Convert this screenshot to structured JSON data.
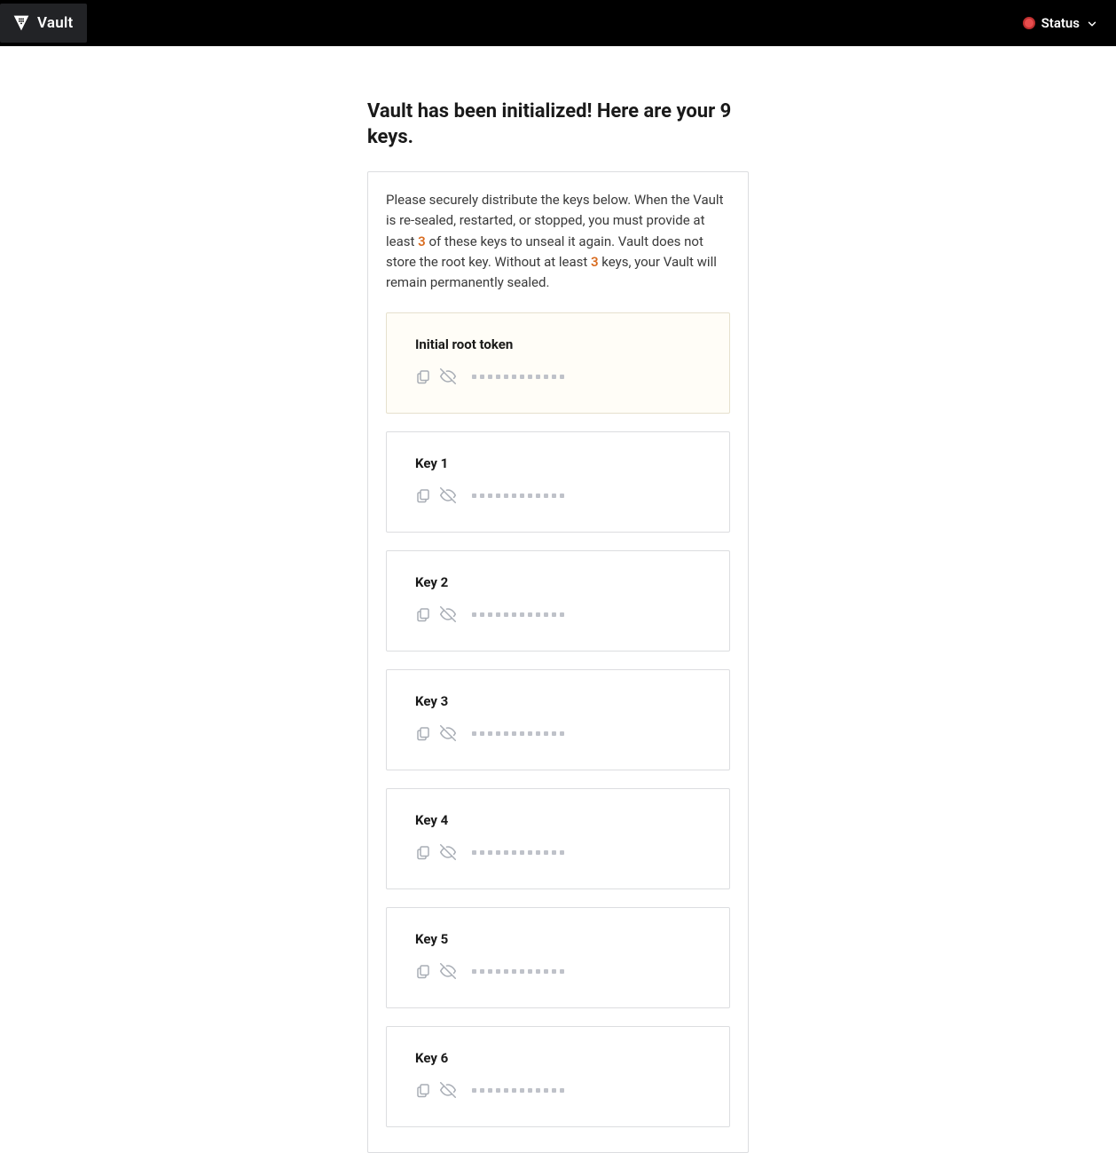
{
  "header": {
    "app_name": "Vault",
    "status_label": "Status",
    "status_color": "#e84e4e"
  },
  "page": {
    "title": "Vault has been initialized! Here are your 9 keys.",
    "info_pre": "Please securely distribute the keys below. When the Vault is re-sealed, restarted, or stopped, you must provide at least ",
    "threshold_a": "3",
    "info_mid": " of these keys to unseal it again. Vault does not store the root key. Without at least ",
    "threshold_b": "3",
    "info_post": " keys, your Vault will remain permanently sealed.",
    "root_token_label": "Initial root token",
    "keys": [
      {
        "label": "Key 1"
      },
      {
        "label": "Key 2"
      },
      {
        "label": "Key 3"
      },
      {
        "label": "Key 4"
      },
      {
        "label": "Key 5"
      },
      {
        "label": "Key 6"
      }
    ],
    "mask_segments": 12
  },
  "icons": {
    "copy": "copy-icon",
    "eye_off": "eye-off-icon",
    "chevron_down": "chevron-down-icon",
    "vault_logo": "vault-logo-icon"
  }
}
